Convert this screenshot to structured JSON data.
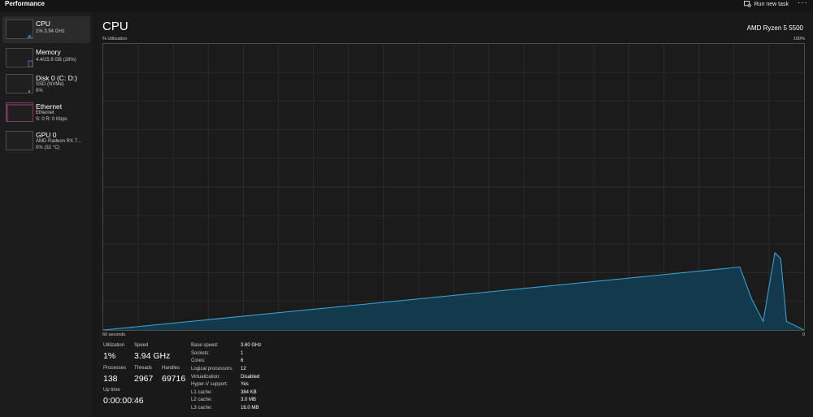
{
  "header": {
    "title": "Performance",
    "run_new_task": "Run new task",
    "more": "···"
  },
  "sidebar": {
    "items": [
      {
        "name": "CPU",
        "sub1": "1% 3.94 GHz",
        "sub2": "",
        "color": "#3fa7d6"
      },
      {
        "name": "Memory",
        "sub1": "4.4/15.9 GB (28%)",
        "sub2": "",
        "color": "#6f8fd6"
      },
      {
        "name": "Disk 0 (C: D:)",
        "sub1": "SSD (NVMe)",
        "sub2": "0%",
        "color": "#7cbf3a"
      },
      {
        "name": "Ethernet",
        "sub1": "Ethernet",
        "sub2": "S: 0 R: 0 Kbps",
        "color": "#c0508a"
      },
      {
        "name": "GPU 0",
        "sub1": "AMD Radeon RX 7...",
        "sub2": "0% (32 °C)",
        "color": "#3fa7d6"
      }
    ]
  },
  "main": {
    "title": "CPU",
    "model": "AMD Ryzen 5 5500",
    "y_label": "% Utilization",
    "y_max_label": "100%",
    "x_left_label": "60 seconds",
    "x_right_label": "0"
  },
  "chart_data": {
    "type": "area",
    "x": [
      60,
      5.5,
      4.5,
      3.5,
      2.5,
      2,
      1.5,
      1,
      0.5,
      0
    ],
    "values": [
      0,
      22,
      11,
      3,
      27,
      25,
      3,
      2,
      1,
      0
    ],
    "ylim": [
      0,
      100
    ],
    "xlim": [
      60,
      0
    ],
    "grid": true,
    "color": "#3fa7d6"
  },
  "stats": {
    "utilization_label": "Utilization",
    "utilization": "1%",
    "speed_label": "Speed",
    "speed": "3.94 GHz",
    "processes_label": "Processes",
    "processes": "138",
    "threads_label": "Threads",
    "threads": "2967",
    "handles_label": "Handles",
    "handles": "69716",
    "uptime_label": "Up time",
    "uptime": "0:00:00:46"
  },
  "info": [
    {
      "label": "Base speed:",
      "value": "3.60 GHz"
    },
    {
      "label": "Sockets:",
      "value": "1"
    },
    {
      "label": "Cores:",
      "value": "6"
    },
    {
      "label": "Logical processors:",
      "value": "12"
    },
    {
      "label": "Virtualization:",
      "value": "Disabled"
    },
    {
      "label": "Hyper-V support:",
      "value": "Yes"
    },
    {
      "label": "L1 cache:",
      "value": "384 KB"
    },
    {
      "label": "L2 cache:",
      "value": "3.0 MB"
    },
    {
      "label": "L3 cache:",
      "value": "16.0 MB"
    }
  ]
}
